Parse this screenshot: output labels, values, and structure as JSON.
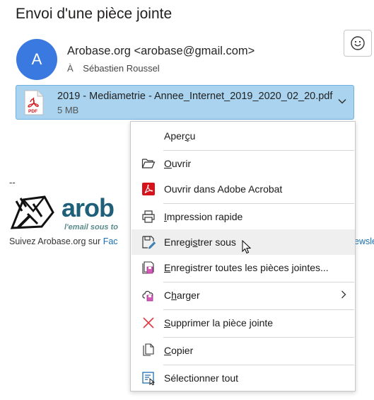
{
  "subject": "Envoi d'une pièce jointe",
  "emoji_icon": "smiley-icon",
  "avatar_initial": "A",
  "sender": "Arobase.org <arobase@gmail.com>",
  "to_label": "À",
  "recipient": "Sébastien Roussel",
  "attachment": {
    "name": "2019 - Mediametrie - Annee_Internet_2019_2020_02_20.pdf",
    "size": "5 MB",
    "icon": "pdf-icon"
  },
  "signature": {
    "dash": "--",
    "logo_text": "arob",
    "tagline": "l'email sous to",
    "follow_prefix": "Suivez Arobase.org sur ",
    "follow_link": "Fac",
    "follow_link_right": "ewsle"
  },
  "context_menu": {
    "items": [
      {
        "key": "preview",
        "pre": "Aper",
        "u": "ç",
        "post": "u",
        "icon": "none"
      },
      {
        "key": "open",
        "pre": "",
        "u": "O",
        "post": "uvrir",
        "icon": "folder-open-icon"
      },
      {
        "key": "open-acrobat",
        "pre": "Ouvrir dans Adobe Acrobat",
        "u": "",
        "post": "",
        "icon": "acrobat-icon"
      },
      {
        "key": "quick-print",
        "pre": "",
        "u": "I",
        "post": "mpression rapide",
        "icon": "printer-icon"
      },
      {
        "key": "save-as",
        "pre": "Enregi",
        "u": "s",
        "post": "trer sous",
        "icon": "save-as-icon"
      },
      {
        "key": "save-all",
        "pre": "",
        "u": "E",
        "post": "nregistrer toutes les pièces jointes...",
        "icon": "save-all-icon"
      },
      {
        "key": "upload",
        "pre": "C",
        "u": "h",
        "post": "arger",
        "icon": "cloud-upload-icon"
      },
      {
        "key": "remove",
        "pre": "",
        "u": "S",
        "post": "upprimer la pièce jointe",
        "icon": "delete-x-icon"
      },
      {
        "key": "copy",
        "pre": "",
        "u": "C",
        "post": "opier",
        "icon": "copy-icon"
      },
      {
        "key": "select-all",
        "pre": "Sélectionner tout",
        "u": "",
        "post": "",
        "icon": "select-all-icon"
      }
    ],
    "hovered": "save-as"
  },
  "colors": {
    "avatar": "#3a79e0",
    "attachment_bg": "#a9d3ee",
    "acrobat_red": "#d4141a",
    "remove_red": "#e0393e"
  }
}
